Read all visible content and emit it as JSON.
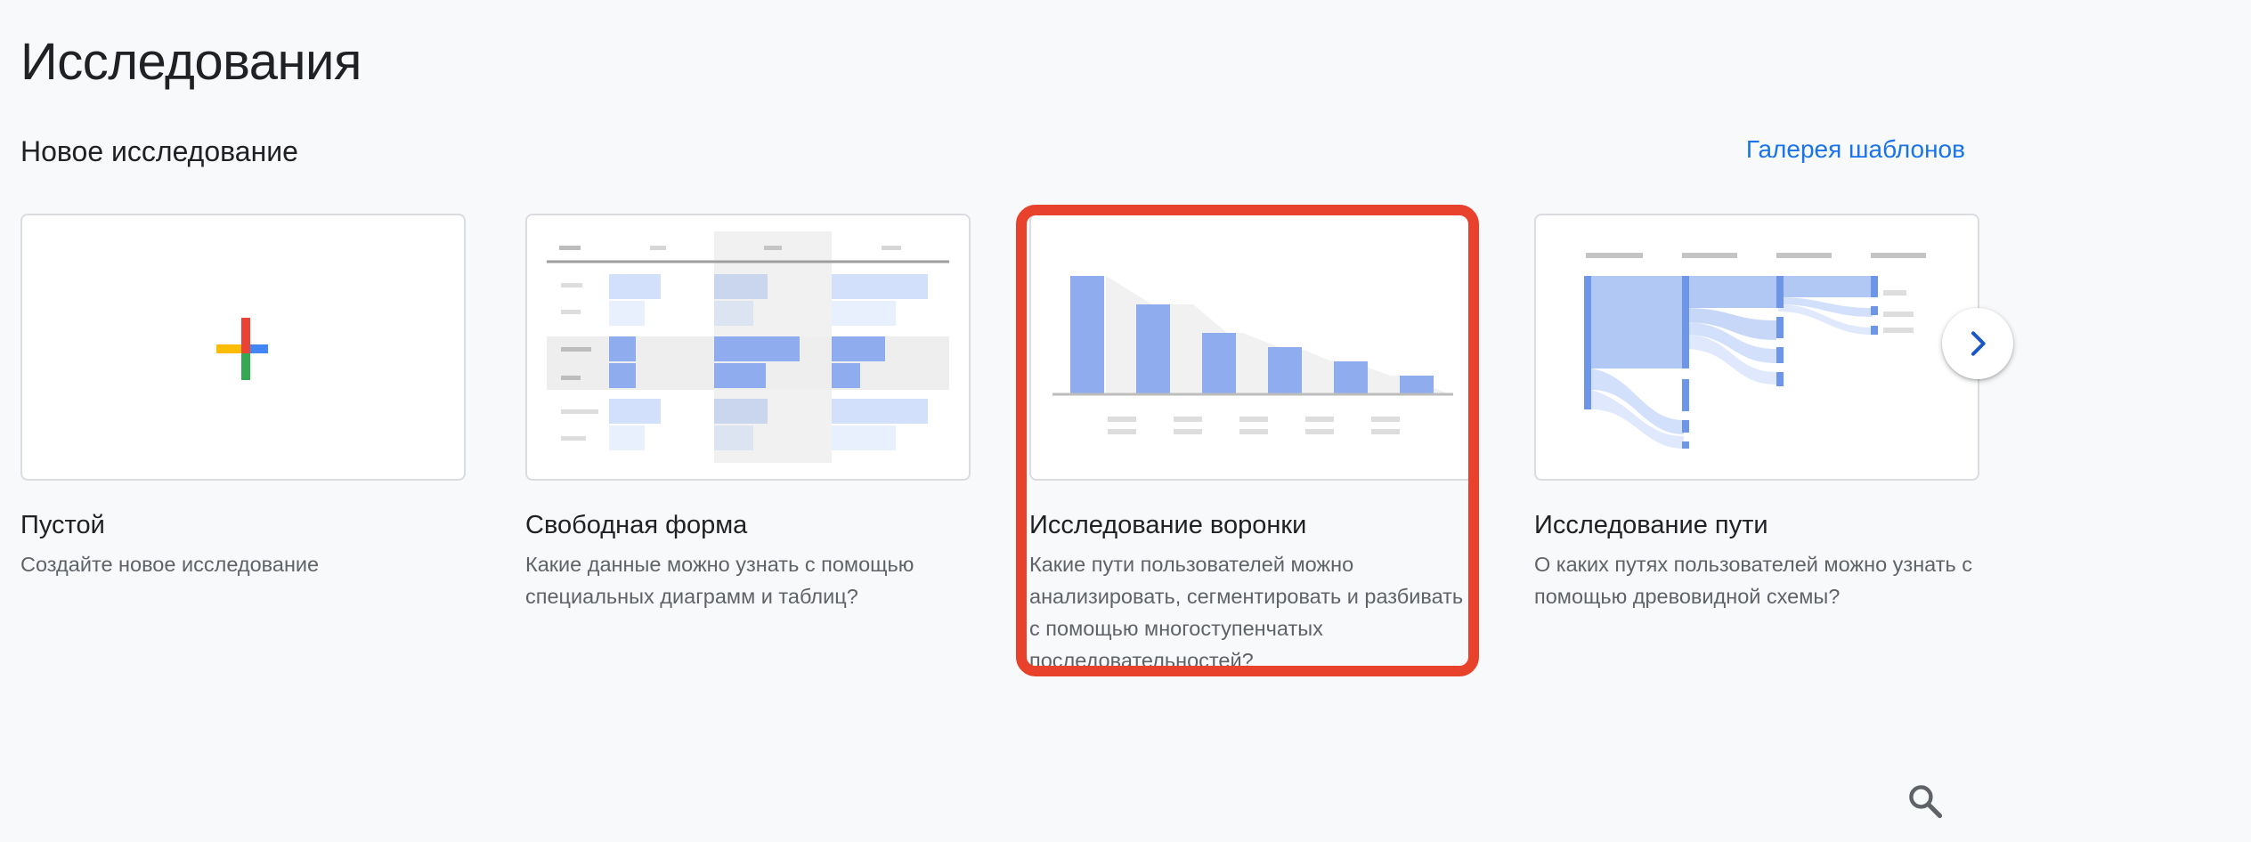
{
  "page": {
    "title": "Исследования"
  },
  "section": {
    "title": "Новое исследование",
    "gallery_link": "Галерея шаблонов"
  },
  "cards": [
    {
      "title": "Пустой",
      "description": "Создайте новое исследование",
      "icon": "plus-icon"
    },
    {
      "title": "Свободная форма",
      "description": "Какие данные можно узнать с помощью специальных диаграмм и таблиц?",
      "icon": "table-illustration"
    },
    {
      "title": "Исследование воронки",
      "description": "Какие пути пользователей можно анализировать, сегментировать и разбивать с помощью многоступенчатых последовательностей?",
      "icon": "funnel-illustration"
    },
    {
      "title": "Исследование пути",
      "description": "О каких путях пользователей можно узнать с помощью древовидной схемы?",
      "icon": "path-tree-illustration"
    }
  ],
  "controls": {
    "next_icon": "chevron-right-icon",
    "search_icon": "search-icon"
  },
  "colors": {
    "accent": "#1a73e8",
    "highlight": "#e8412c",
    "bar_blue": "#8fadee",
    "bar_light": "#d2e0fb"
  }
}
